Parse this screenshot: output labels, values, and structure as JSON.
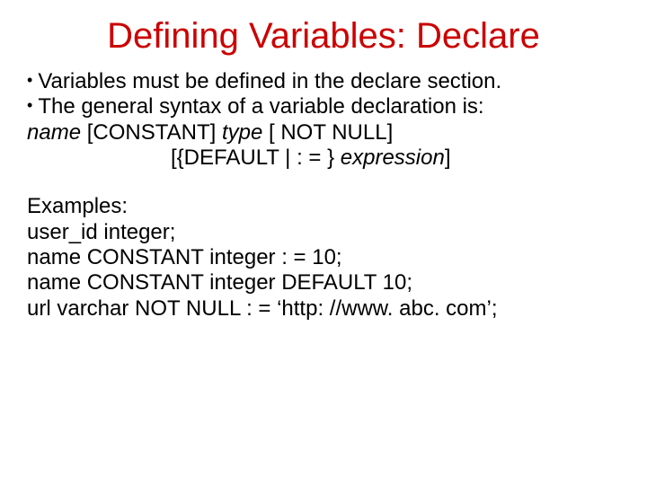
{
  "title": "Defining Variables: Declare",
  "bullets": [
    "Variables must be defined in the declare section.",
    "The general syntax of a variable declaration is:"
  ],
  "syntax": {
    "name": "name",
    "constant": "  [CONSTANT] ",
    "type": "type",
    "notnull": " [ NOT NULL]",
    "line2_prefix": "[{DEFAULT | : = } ",
    "expr": "expression",
    "line2_suffix": "]"
  },
  "examples_heading": "Examples:",
  "examples": [
    "user_id integer;",
    "name CONSTANT integer : = 10;",
    "name CONSTANT integer DEFAULT 10;",
    "url varchar NOT NULL : = ‘http: //www. abc. com’;"
  ]
}
